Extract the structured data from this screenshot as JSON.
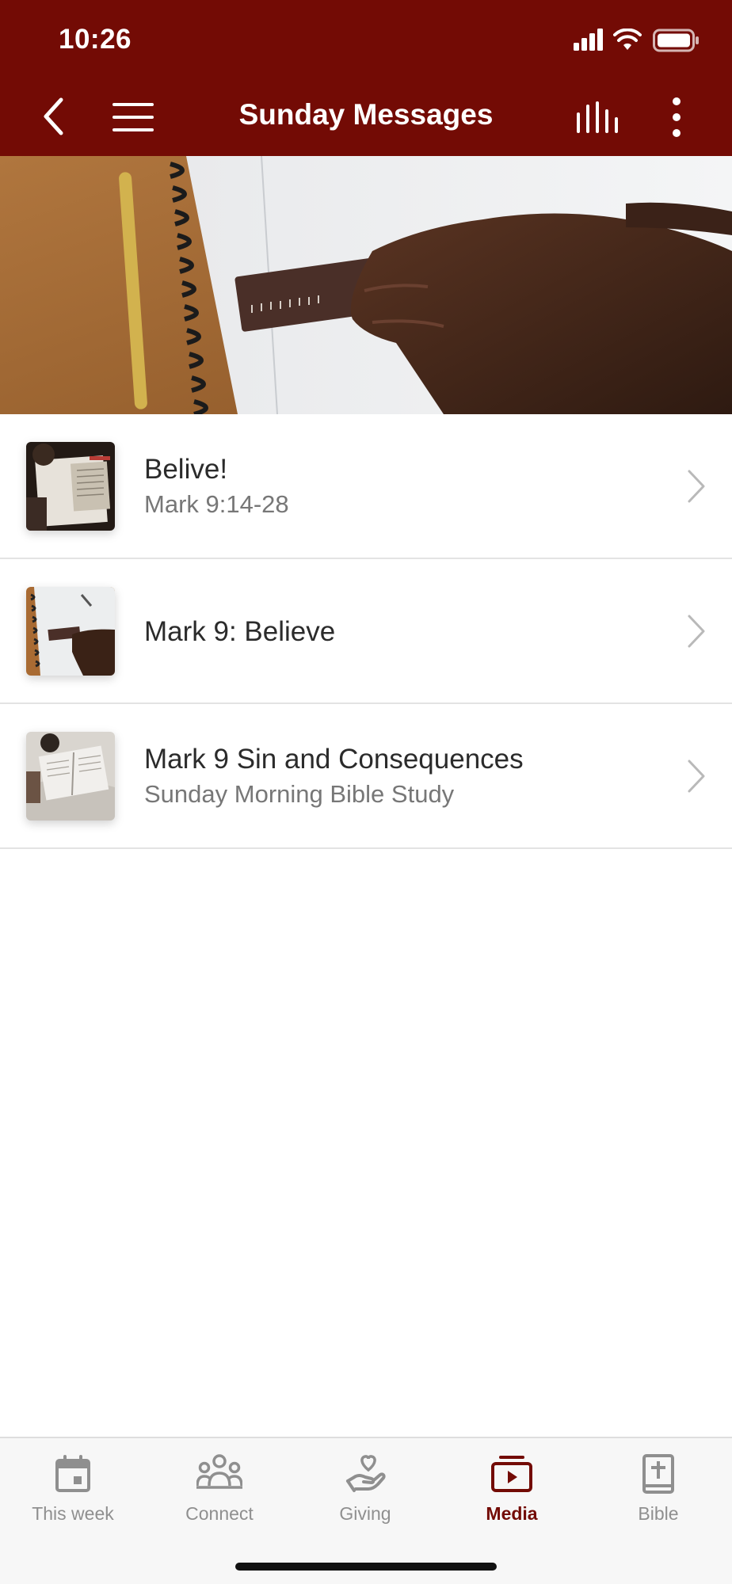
{
  "status": {
    "time": "10:26"
  },
  "header": {
    "title": "Sunday Messages",
    "icons": [
      "back-icon",
      "menu-icon",
      "stats-icon",
      "more-icon"
    ],
    "bg_color": "#730b05"
  },
  "messages": [
    {
      "title": "Belive!",
      "subtitle": "Mark 9:14-28"
    },
    {
      "title": "Mark 9: Believe",
      "subtitle": ""
    },
    {
      "title": "Mark 9 Sin and Consequences",
      "subtitle": "Sunday Morning Bible Study"
    }
  ],
  "tabs": [
    {
      "label": "This week",
      "icon": "calendar-icon",
      "active": false
    },
    {
      "label": "Connect",
      "icon": "people-icon",
      "active": false
    },
    {
      "label": "Giving",
      "icon": "giving-hand-icon",
      "active": false
    },
    {
      "label": "Media",
      "icon": "media-icon",
      "active": true
    },
    {
      "label": "Bible",
      "icon": "bible-icon",
      "active": false
    }
  ],
  "colors": {
    "accent": "#730b05",
    "inactive_tab": "#8f8f8f"
  }
}
